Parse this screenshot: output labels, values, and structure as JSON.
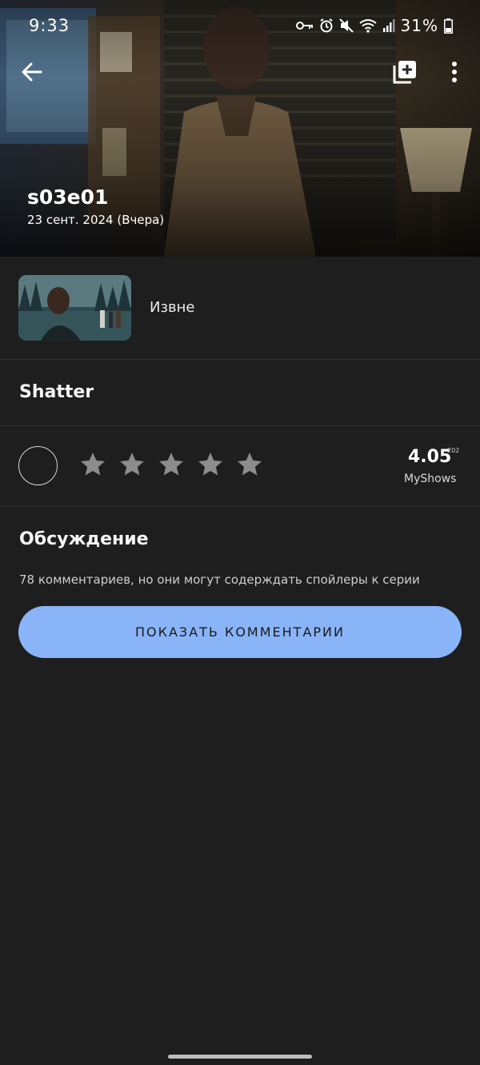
{
  "status_bar": {
    "time": "9:33",
    "battery_percent": "31%",
    "icons": [
      "key-icon",
      "alarm-icon",
      "mute-icon",
      "wifi-icon",
      "signal-icon",
      "battery-icon"
    ]
  },
  "header": {
    "back_icon": "arrow-left-icon",
    "add_icon": "add-to-library-icon",
    "more_icon": "more-vertical-icon",
    "episode_code": "s03e01",
    "air_date": "23 сент. 2024 (Вчера)"
  },
  "show": {
    "title": "Извне"
  },
  "episode": {
    "title": "Shatter"
  },
  "rating": {
    "stars_total": 5,
    "user_rating": 0,
    "value": "4.05",
    "count": "202",
    "source": "MyShows",
    "star_color": "#8c8c8c"
  },
  "discussion": {
    "title": "Обсуждение",
    "text": "78 комментариев, но они могут содерждать спойлеры к серии",
    "button_label": "ПОКАЗАТЬ КОММЕНТАРИИ",
    "button_color": "#8ab4f8"
  },
  "theme": {
    "background": "#1e1e1e",
    "divider": "#2e2e2e",
    "text": "#f2f2f2"
  }
}
